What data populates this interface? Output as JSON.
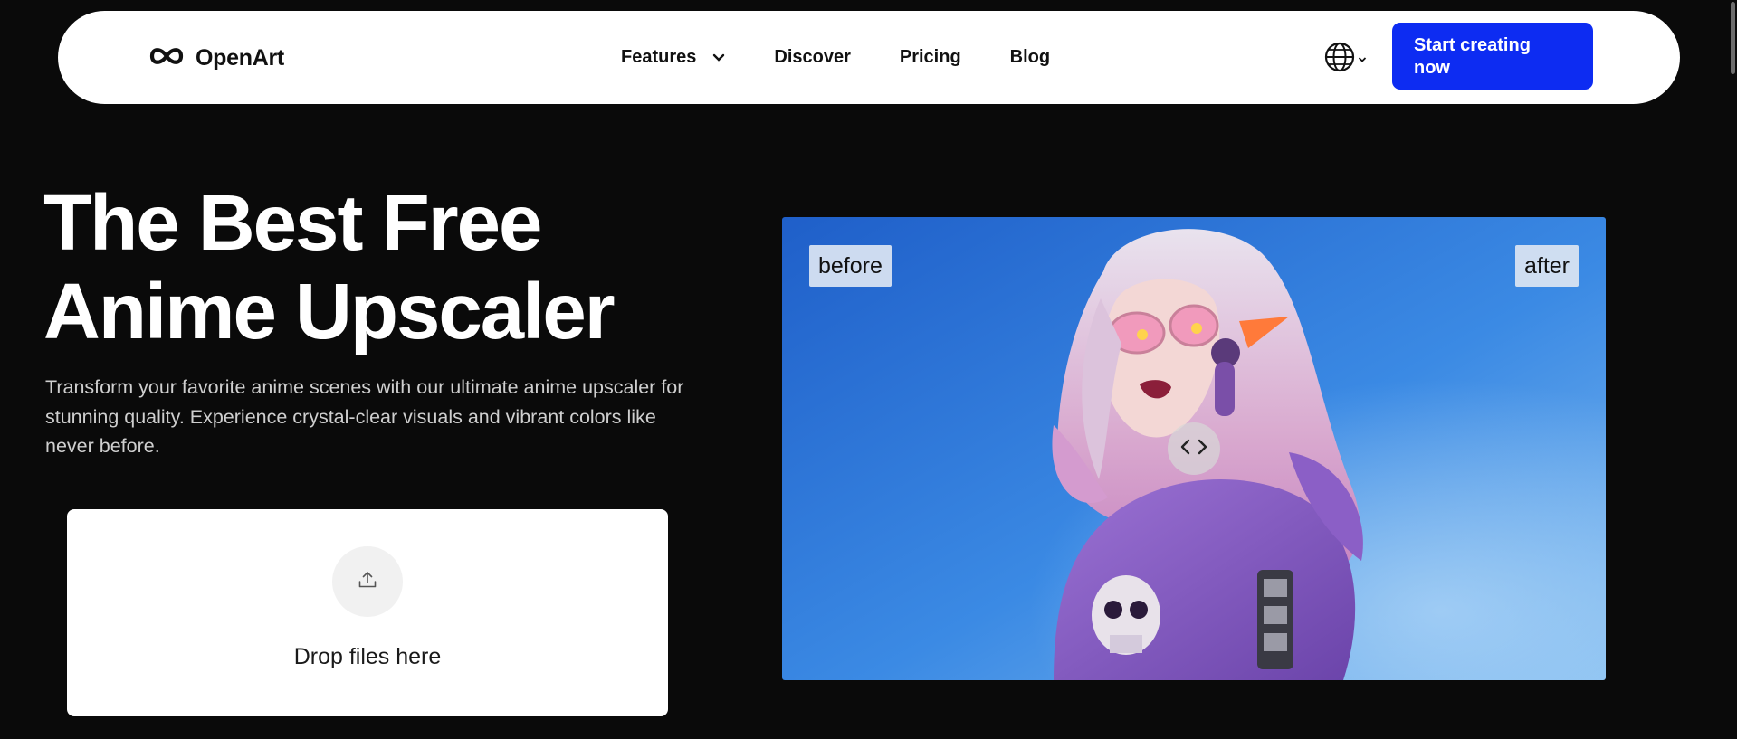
{
  "nav": {
    "brand": "OpenArt",
    "links": [
      "Features",
      "Discover",
      "Pricing",
      "Blog"
    ],
    "cta": "Start creating now",
    "icons": [
      "openart-logo-icon",
      "chevron-down-icon",
      "globe-icon"
    ]
  },
  "hero": {
    "title_line1": "The Best Free",
    "title_line2": "Anime Upscaler",
    "description": "Transform your favorite anime scenes with our ultimate anime upscaler for stunning quality. Experience crystal-clear visuals and vibrant colors like never before."
  },
  "dropzone": {
    "label": "Drop files here",
    "icon": "upload-icon"
  },
  "compare": {
    "before_label": "before",
    "after_label": "after",
    "handle_icon": "compare-arrows-icon"
  },
  "colors": {
    "background": "#0a0a0a",
    "nav_bg": "#ffffff",
    "accent": "#0d2cf2",
    "sky": "#2f7fdc",
    "hoodie": "#8a5fc4"
  }
}
